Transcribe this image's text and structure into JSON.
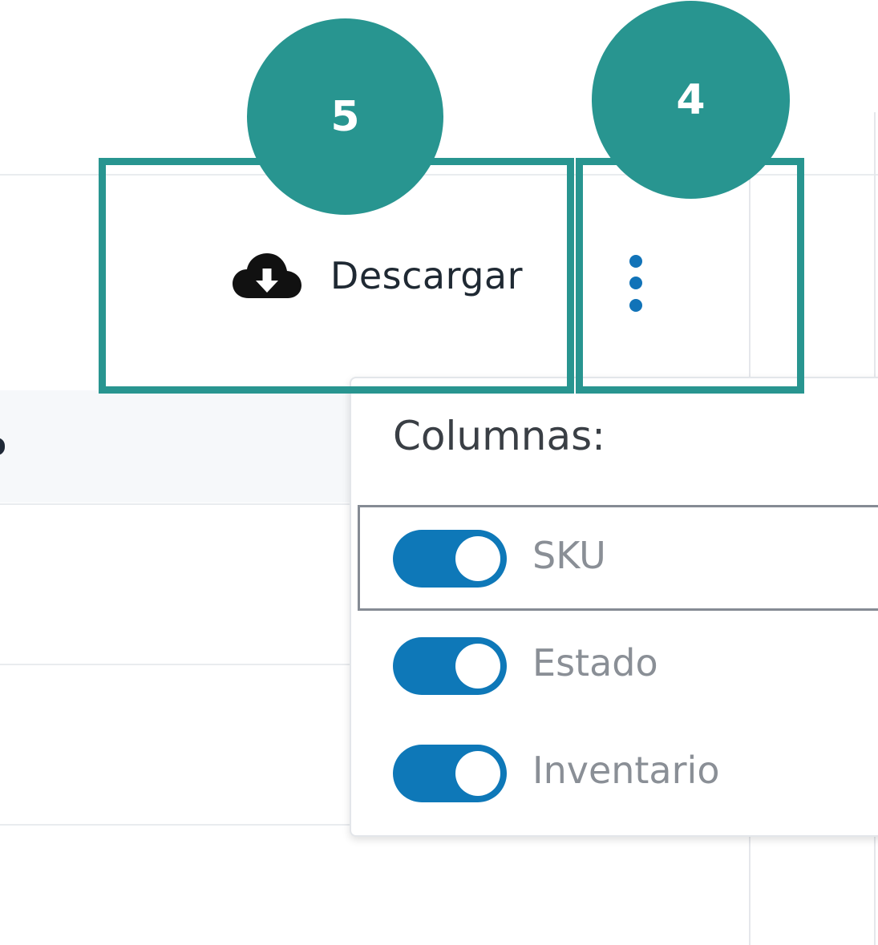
{
  "toolbar": {
    "download_label": "Descargar",
    "download_icon": "cloud-download-icon",
    "menu_icon": "kebab-menu-icon"
  },
  "annotations": [
    {
      "number": "5",
      "target": "download-button"
    },
    {
      "number": "4",
      "target": "column-menu-button"
    }
  ],
  "columns_popup": {
    "title": "Columnas:",
    "options": [
      {
        "label": "SKU",
        "enabled": true
      },
      {
        "label": "Estado",
        "enabled": true
      },
      {
        "label": "Inventario",
        "enabled": true
      }
    ]
  },
  "colors": {
    "annotation_teal": "#289590",
    "toggle_blue": "#0e78b8",
    "dot_blue": "#1173b8"
  }
}
